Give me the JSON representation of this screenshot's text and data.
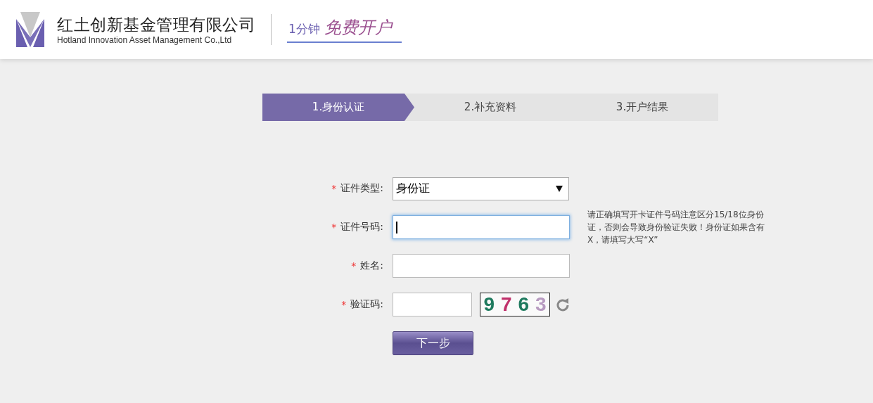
{
  "header": {
    "company_name": "红土创新基金管理有限公司",
    "company_name_en": "Hotland Innovation Asset Management Co.,Ltd",
    "slogan_prefix": "1分钟",
    "slogan": "免费开户"
  },
  "steps": [
    {
      "label": "1.身份认证",
      "selected": true
    },
    {
      "label": "2.补充资料",
      "selected": false
    },
    {
      "label": "3.开户结果",
      "selected": false
    }
  ],
  "form": {
    "fields": [
      {
        "kind": "select",
        "label": "证件类型:",
        "required_mark": "*",
        "value": "身份证"
      },
      {
        "kind": "text",
        "label": "证件号码:",
        "required_mark": "*",
        "focused": true,
        "hint": "请正确填写开卡证件号码注意区分15/18位身份证，否则会导致身份验证失败！身份证如果含有X，请填写大写“X”"
      },
      {
        "kind": "text",
        "label": "姓名:",
        "required_mark": "*",
        "focused": false
      },
      {
        "kind": "captcha",
        "label": "验证码:",
        "required_mark": "*",
        "captcha": [
          {
            "char": "9",
            "color": "#1e7a5e"
          },
          {
            "char": "7",
            "color": "#c0306a"
          },
          {
            "char": "6",
            "color": "#1e7a5e"
          },
          {
            "char": "3",
            "color": "#b79ac0"
          }
        ]
      }
    ],
    "submit": "下一步"
  }
}
